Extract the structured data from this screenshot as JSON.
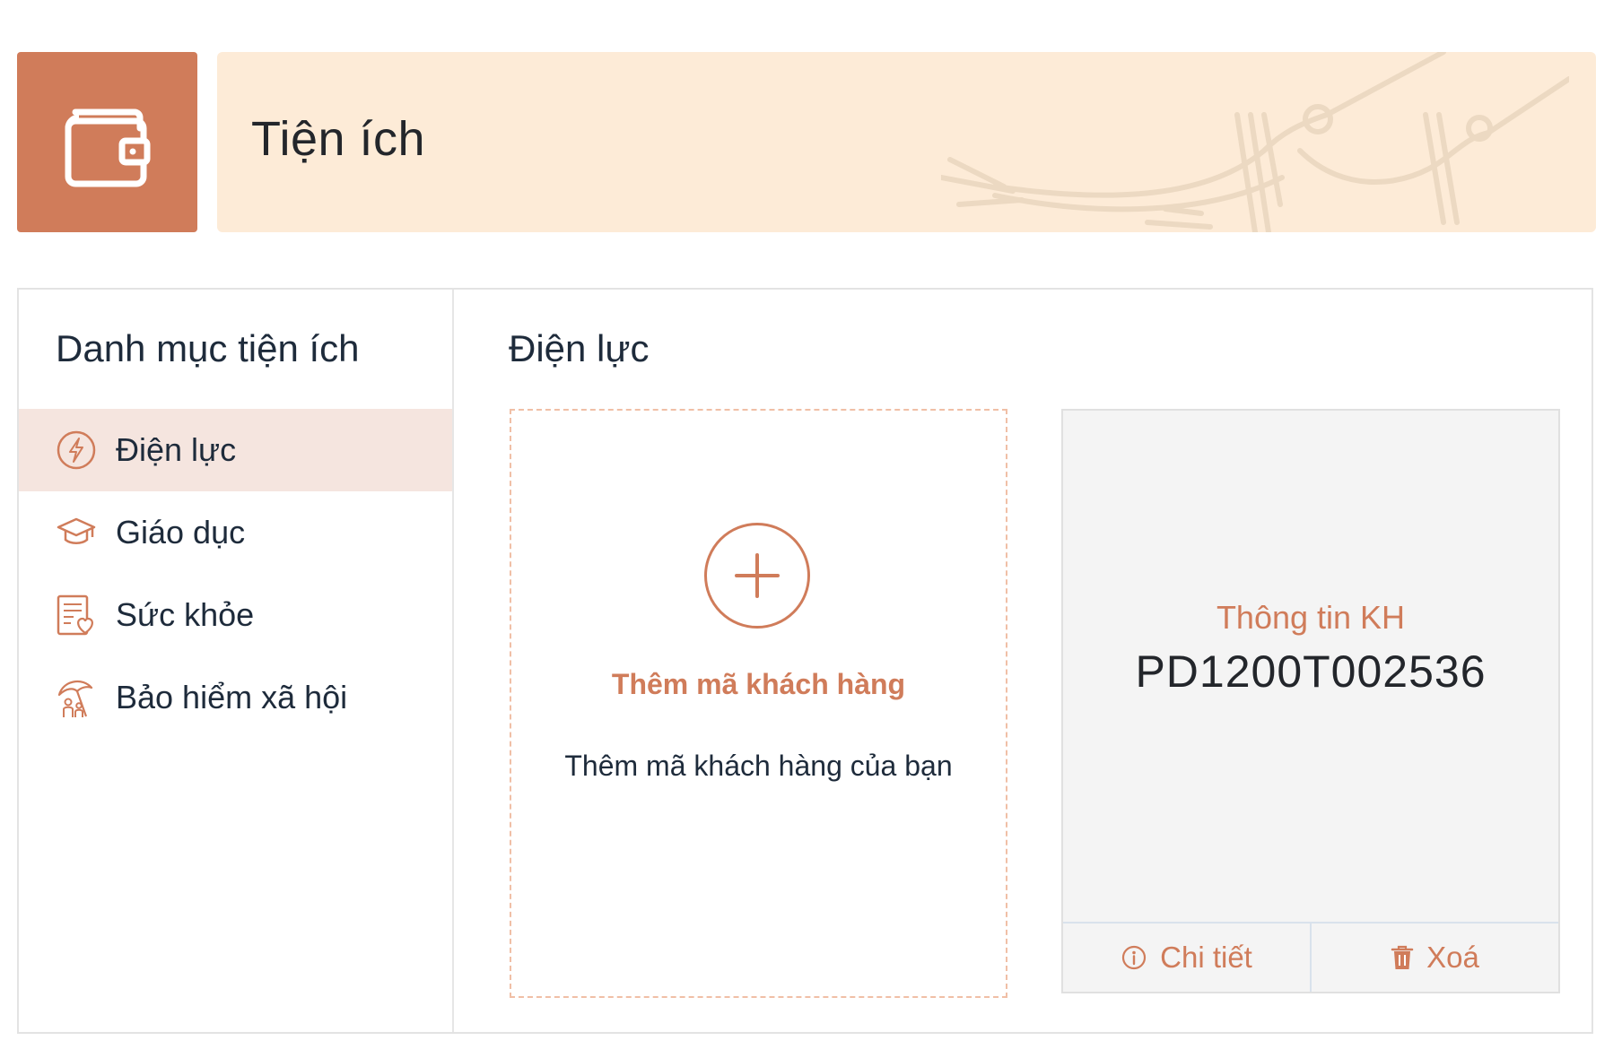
{
  "header": {
    "title": "Tiện ích",
    "icon": "wallet-icon",
    "accent_color": "#d07c5a",
    "banner_color": "#fdebd7"
  },
  "sidebar": {
    "title": "Danh mục tiện ích",
    "items": [
      {
        "label": "Điện lực",
        "icon": "lightning-icon",
        "active": true
      },
      {
        "label": "Giáo dục",
        "icon": "graduation-cap-icon",
        "active": false
      },
      {
        "label": "Sức khỏe",
        "icon": "health-report-icon",
        "active": false
      },
      {
        "label": "Bảo hiểm xã hội",
        "icon": "umbrella-family-icon",
        "active": false
      }
    ]
  },
  "main": {
    "title": "Điện lực",
    "add_card": {
      "label": "Thêm mã khách hàng",
      "description": "Thêm mã khách hàng của bạn",
      "icon": "plus-icon"
    },
    "customer_card": {
      "label": "Thông tin KH",
      "code": "PD1200T002536",
      "detail_button": "Chi tiết",
      "detail_icon": "info-icon",
      "delete_button": "Xoá",
      "delete_icon": "trash-icon"
    }
  }
}
